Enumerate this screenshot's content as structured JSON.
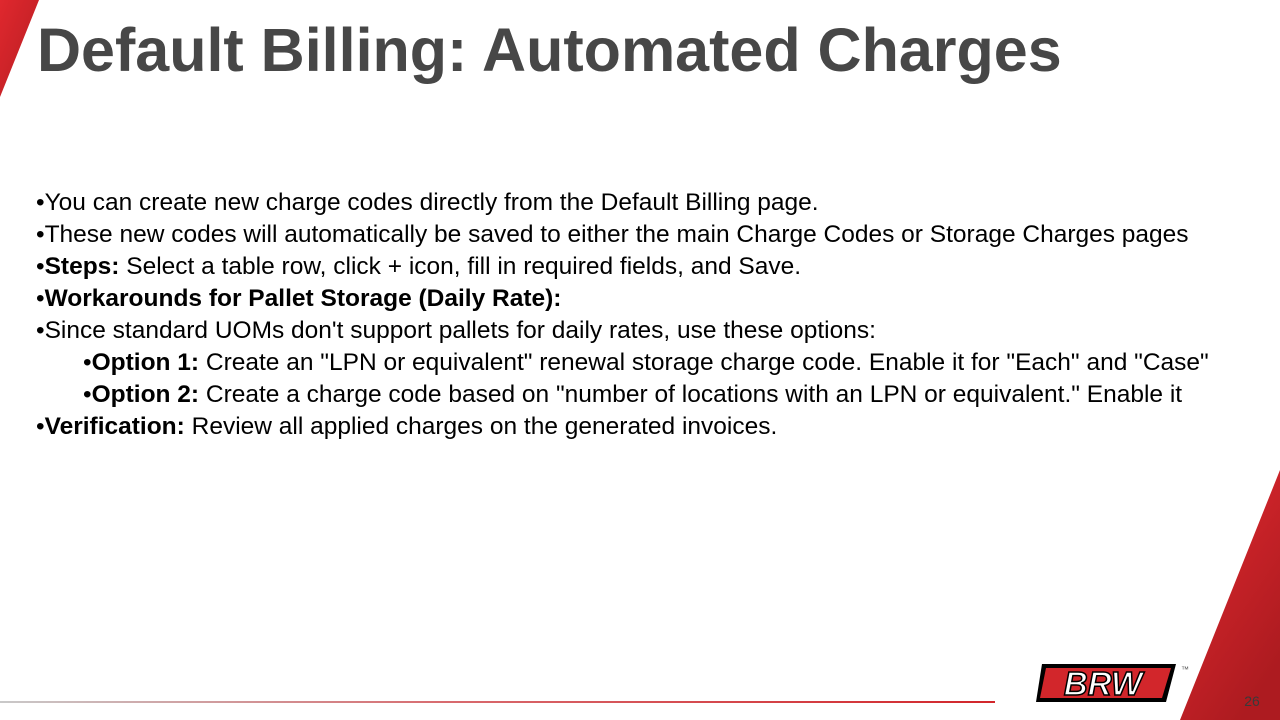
{
  "slide": {
    "title": "Default Billing: Automated Charges",
    "page_number": "26"
  },
  "bullets": [
    {
      "level": 1,
      "marker": "•",
      "bold": "",
      "text": "You can create new charge codes directly from the Default Billing page."
    },
    {
      "level": 1,
      "marker": "•",
      "bold": "",
      "text": "These new codes will automatically be saved to either the main Charge Codes or Storage Charges pages"
    },
    {
      "level": 1,
      "marker": "•",
      "bold": "Steps:",
      "text": " Select a table row, click + icon, fill in required fields, and Save."
    },
    {
      "level": 1,
      "marker": "•",
      "bold": "Workarounds for Pallet Storage (Daily Rate):",
      "text": ""
    },
    {
      "level": 1,
      "marker": "•",
      "bold": "",
      "text": "Since standard UOMs don't support pallets for daily rates, use these options:"
    },
    {
      "level": 2,
      "marker": "•",
      "bold": "Option 1:",
      "text": " Create an \"LPN or equivalent\" renewal storage charge code. Enable it for \"Each\" and \"Case\""
    },
    {
      "level": 2,
      "marker": "•",
      "bold": "Option 2:",
      "text": " Create a charge code based on \"number of locations with an LPN or equivalent.\" Enable it"
    },
    {
      "level": 1,
      "marker": "•",
      "bold": "Verification:",
      "text": " Review all applied charges on the generated invoices."
    }
  ],
  "branding": {
    "logo_text": "BRW",
    "trademark": "™",
    "accent_color": "#d2262b",
    "accent_dark": "#a8191d",
    "title_color": "#474747"
  }
}
